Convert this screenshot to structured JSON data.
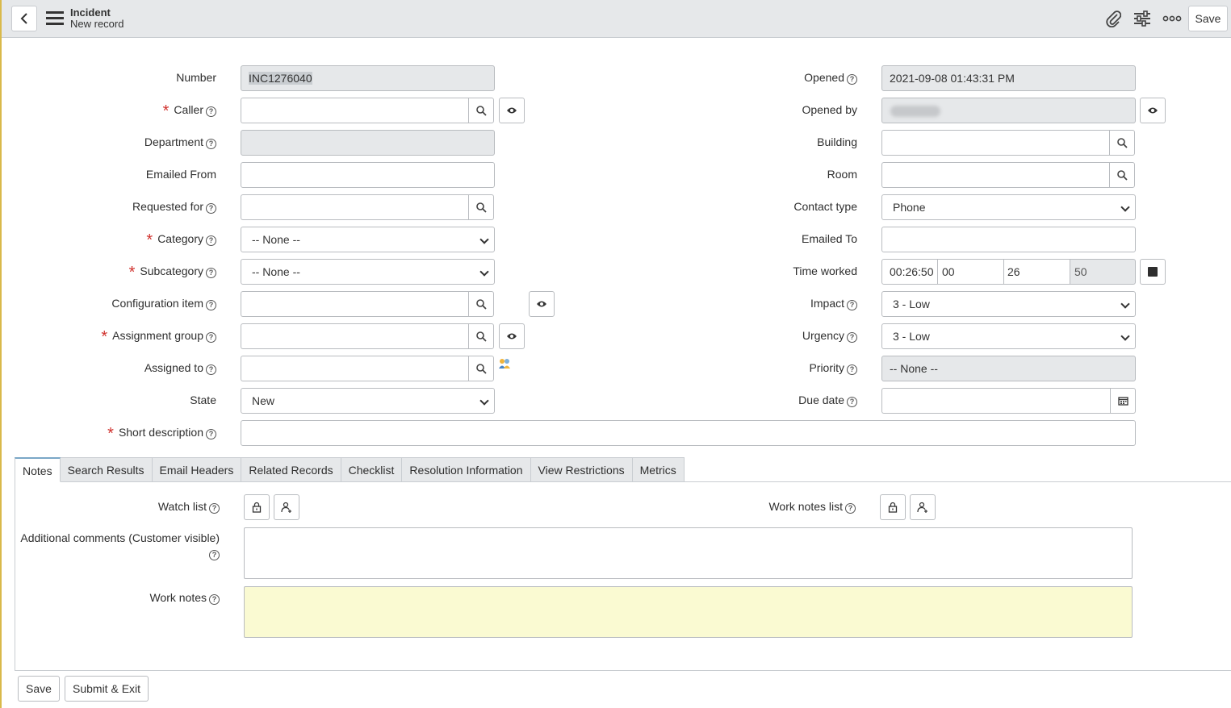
{
  "header": {
    "title": "Incident",
    "subtitle": "New record",
    "save_label": "Save"
  },
  "left_fields": {
    "number": {
      "label": "Number",
      "value": "INC1276040"
    },
    "caller": {
      "label": "Caller",
      "value": ""
    },
    "department": {
      "label": "Department",
      "value": ""
    },
    "emailed_from": {
      "label": "Emailed From",
      "value": ""
    },
    "requested_for": {
      "label": "Requested for",
      "value": ""
    },
    "category": {
      "label": "Category",
      "value": "-- None --"
    },
    "subcategory": {
      "label": "Subcategory",
      "value": "-- None --"
    },
    "configuration_item": {
      "label": "Configuration item",
      "value": ""
    },
    "assignment_group": {
      "label": "Assignment group",
      "value": ""
    },
    "assigned_to": {
      "label": "Assigned to",
      "value": ""
    },
    "state": {
      "label": "State",
      "value": "New"
    },
    "short_description": {
      "label": "Short description",
      "value": ""
    }
  },
  "right_fields": {
    "opened": {
      "label": "Opened",
      "value": "2021-09-08 01:43:31 PM"
    },
    "opened_by": {
      "label": "Opened by",
      "value": ""
    },
    "building": {
      "label": "Building",
      "value": ""
    },
    "room": {
      "label": "Room",
      "value": ""
    },
    "contact_type": {
      "label": "Contact type",
      "value": "Phone"
    },
    "emailed_to": {
      "label": "Emailed To",
      "value": ""
    },
    "time_worked": {
      "label": "Time worked",
      "total": "00:26:50",
      "hours": "00",
      "minutes": "26",
      "seconds": "50"
    },
    "impact": {
      "label": "Impact",
      "value": "3 - Low"
    },
    "urgency": {
      "label": "Urgency",
      "value": "3 - Low"
    },
    "priority": {
      "label": "Priority",
      "value": "-- None --"
    },
    "due_date": {
      "label": "Due date",
      "value": ""
    }
  },
  "tabs": [
    {
      "label": "Notes"
    },
    {
      "label": "Search Results"
    },
    {
      "label": "Email Headers"
    },
    {
      "label": "Related Records"
    },
    {
      "label": "Checklist"
    },
    {
      "label": "Resolution Information"
    },
    {
      "label": "View Restrictions"
    },
    {
      "label": "Metrics"
    }
  ],
  "notes": {
    "watch_list_label": "Watch list",
    "work_notes_list_label": "Work notes list",
    "additional_comments_label": "Additional comments (Customer visible)",
    "work_notes_label": "Work notes"
  },
  "footer": {
    "save_label": "Save",
    "submit_exit_label": "Submit & Exit"
  },
  "colors": {
    "required": "#d0312d",
    "readonly_bg": "#e6e8ea",
    "work_notes_bg": "#fafad2",
    "header_bg": "#e6e8ea"
  },
  "help_glyph": "?"
}
